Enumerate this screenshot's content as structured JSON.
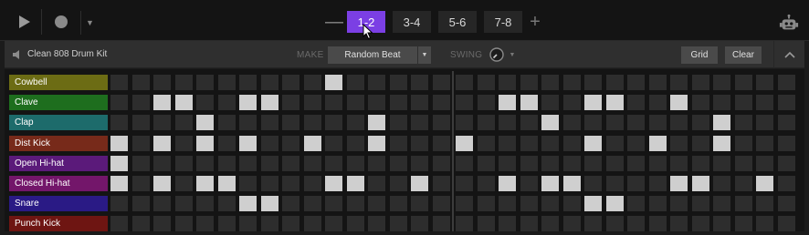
{
  "topbar": {
    "play_icon": "play-icon",
    "record_icon": "record-icon",
    "record_menu_icon": "chevron-down-icon",
    "minus_label": "—",
    "plus_label": "+",
    "pages": [
      {
        "label": "1-2",
        "active": true
      },
      {
        "label": "3-4",
        "active": false
      },
      {
        "label": "5-6",
        "active": false
      },
      {
        "label": "7-8",
        "active": false
      }
    ],
    "robot_icon": "robot-icon"
  },
  "subbar": {
    "kit_name": "Clean 808 Drum Kit",
    "make_label": "MAKE",
    "random_beat_label": "Random Beat",
    "swing_label": "SWING",
    "grid_label": "Grid",
    "clear_label": "Clear"
  },
  "colors": {
    "accent": "#7b3fe4",
    "step_on": "#cfcfcf",
    "step_off": "#2d2d2d"
  },
  "tracks": [
    {
      "name": "Cowbell",
      "color": "#6c6c14",
      "text": "#ffffff",
      "steps": [
        0,
        0,
        0,
        0,
        0,
        0,
        0,
        0,
        0,
        0,
        1,
        0,
        0,
        0,
        0,
        0,
        0,
        0,
        0,
        0,
        0,
        0,
        0,
        0,
        0,
        0,
        0,
        0,
        0,
        0,
        0,
        0
      ]
    },
    {
      "name": "Clave",
      "color": "#1e6e1e",
      "text": "#ffffff",
      "steps": [
        0,
        0,
        1,
        1,
        0,
        0,
        1,
        1,
        0,
        0,
        0,
        0,
        0,
        0,
        0,
        0,
        0,
        0,
        1,
        1,
        0,
        0,
        1,
        1,
        0,
        0,
        1,
        0,
        0,
        0,
        0,
        0
      ]
    },
    {
      "name": "Clap",
      "color": "#1d6b6b",
      "text": "#ffffff",
      "steps": [
        0,
        0,
        0,
        0,
        1,
        0,
        0,
        0,
        0,
        0,
        0,
        0,
        1,
        0,
        0,
        0,
        0,
        0,
        0,
        0,
        1,
        0,
        0,
        0,
        0,
        0,
        0,
        0,
        1,
        0,
        0,
        0
      ]
    },
    {
      "name": "Dist Kick",
      "color": "#772a1a",
      "text": "#ffffff",
      "steps": [
        1,
        0,
        1,
        0,
        1,
        0,
        1,
        0,
        0,
        1,
        0,
        0,
        1,
        0,
        0,
        0,
        1,
        0,
        0,
        0,
        0,
        0,
        1,
        0,
        0,
        1,
        0,
        0,
        1,
        0,
        0,
        0
      ]
    },
    {
      "name": "Open Hi-hat",
      "color": "#5b1a7a",
      "text": "#ffffff",
      "steps": [
        1,
        0,
        0,
        0,
        0,
        0,
        0,
        0,
        0,
        0,
        0,
        0,
        0,
        0,
        0,
        0,
        0,
        0,
        0,
        0,
        0,
        0,
        0,
        0,
        0,
        0,
        0,
        0,
        0,
        0,
        0,
        0
      ]
    },
    {
      "name": "Closed Hi-hat",
      "color": "#73166a",
      "text": "#ffffff",
      "steps": [
        1,
        0,
        1,
        0,
        1,
        1,
        0,
        0,
        0,
        0,
        1,
        1,
        0,
        0,
        1,
        0,
        0,
        0,
        1,
        0,
        1,
        1,
        0,
        0,
        0,
        0,
        1,
        1,
        0,
        0,
        1,
        0
      ]
    },
    {
      "name": "Snare",
      "color": "#2a1a85",
      "text": "#ffffff",
      "steps": [
        0,
        0,
        0,
        0,
        0,
        0,
        1,
        1,
        0,
        0,
        0,
        0,
        0,
        0,
        0,
        0,
        0,
        0,
        0,
        0,
        0,
        0,
        1,
        1,
        0,
        0,
        0,
        0,
        0,
        0,
        0,
        0
      ]
    },
    {
      "name": "Punch Kick",
      "color": "#6e1512",
      "text": "#ffffff",
      "steps": [
        0,
        0,
        0,
        0,
        0,
        0,
        0,
        0,
        0,
        0,
        0,
        0,
        0,
        0,
        0,
        0,
        0,
        0,
        0,
        0,
        0,
        0,
        0,
        0,
        0,
        0,
        0,
        0,
        0,
        0,
        0,
        0
      ]
    }
  ]
}
